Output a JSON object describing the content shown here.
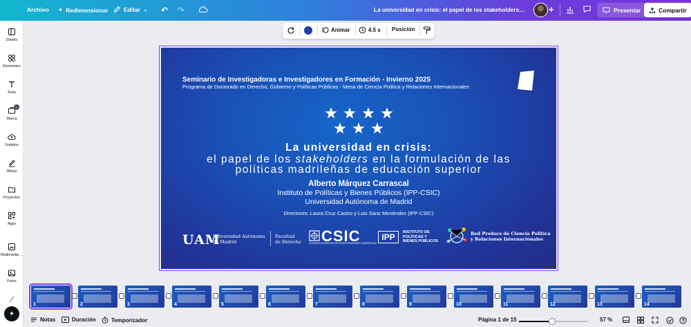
{
  "topbar": {
    "archivo": "Archivo",
    "redimensionar": "Redimensionar",
    "editar": "Editar",
    "doc_title": "La universidad en crisis: el papel de los stakeholders en la f...",
    "presentar": "Presentar",
    "compartir": "Compartir"
  },
  "sidebar": {
    "items": [
      {
        "label": "Diseño",
        "icon": "layout-icon"
      },
      {
        "label": "Elementos",
        "icon": "shapes-icon"
      },
      {
        "label": "Texto",
        "icon": "text-icon"
      },
      {
        "label": "Marca",
        "icon": "brand-icon"
      },
      {
        "label": "Subidos",
        "icon": "upload-cloud-icon"
      },
      {
        "label": "Dibujo",
        "icon": "pen-icon"
      },
      {
        "label": "Proyectos",
        "icon": "folder-icon"
      },
      {
        "label": "Apps",
        "icon": "apps-icon"
      },
      {
        "label": "Multimedia ...",
        "icon": "media-icon"
      },
      {
        "label": "Fotos",
        "icon": "photo-icon"
      }
    ]
  },
  "floatbar": {
    "animar": "Animar",
    "duration": "4.5 s",
    "posicion": "Posición",
    "color": "#1e3fa8"
  },
  "slide": {
    "seminar": "Seminario de Investigadoras e Investigadores en Formación - Invierno 2025",
    "program": "Programa de Doctorado en Derecho, Gobierno y Políticas Públicas - Mesa de Ciencia Política y Relaciones Internacionales",
    "title1": "La universidad en crisis:",
    "title2a": "el papel de los ",
    "title2b": "stakeholders",
    "title2c": " en la formulación de las",
    "title3": "políticas madrileñas de educación superior",
    "author": "Alberto Márquez Carrascal",
    "institute": "Instituto de Políticas y Bienes Públicos (IPP-CSIC)",
    "university": "Universidad Autónoma de Madrid",
    "directors": "Directores: Laura Cruz Castro y Luis Sanz Menéndez (IPP-CSIC)",
    "logos": {
      "uam": "UAM",
      "uam_sub1": "Universidad Autónoma",
      "uam_sub2": "de Madrid",
      "fac1": "Facultad",
      "fac2": "de Derecho",
      "csic": "CSIC",
      "csic_sub": "CONSEJO SUPERIOR DE INVESTIGACIONES CIENTÍFICAS",
      "ipp": "IPP",
      "ipp_sub1": "INSTITUTO DE",
      "ipp_sub2": "POLÍTICAS Y",
      "ipp_sub3": "BIENES PÚBLICOS",
      "red1": "Red Predocs de Ciencia Política",
      "red2": "y Relaciones Internacionales"
    }
  },
  "filmstrip": {
    "slides": [
      "1",
      "2",
      "3",
      "4",
      "5",
      "6",
      "7",
      "8",
      "9",
      "10",
      "11",
      "12",
      "13",
      "14"
    ]
  },
  "bottombar": {
    "notas": "Notas",
    "duracion": "Duración",
    "temporizador": "Temporizador",
    "page": "Página 1 de 15",
    "zoom_pct": 57,
    "zoom": "57 %"
  }
}
